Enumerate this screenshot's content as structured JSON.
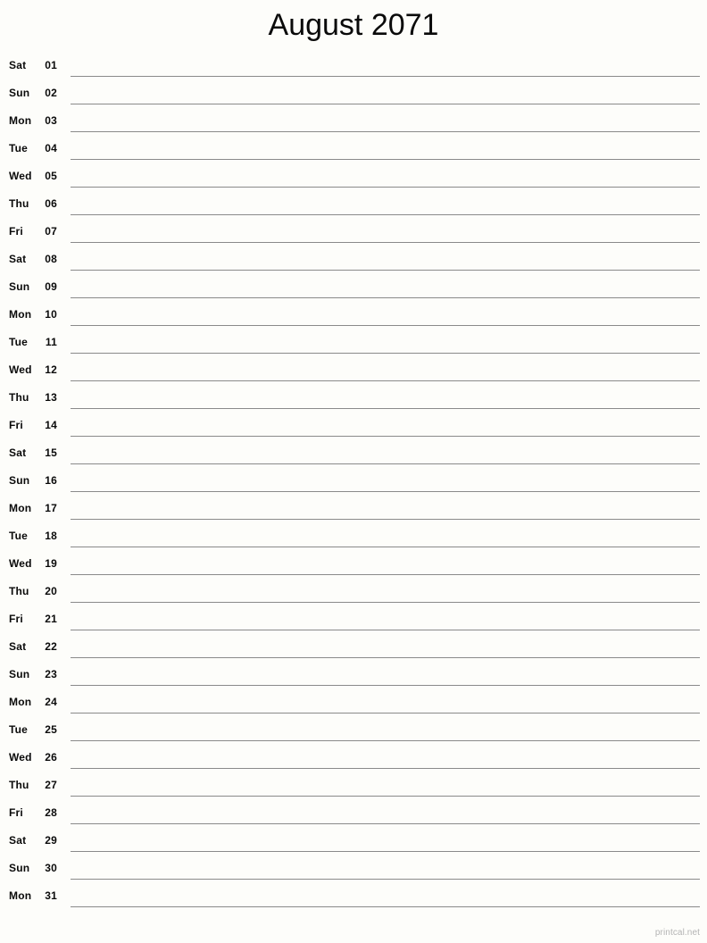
{
  "document": {
    "title": "August 2071",
    "month": "August",
    "year": "2071",
    "layout": "notes-column-single",
    "paper": "letter-portrait"
  },
  "colors": {
    "background": "#fdfdfa",
    "text": "#0a0a0a",
    "rule_line": "#8a8a8a",
    "footer_text": "#b4b4b4"
  },
  "days": [
    {
      "weekday": "Sat",
      "number": "01"
    },
    {
      "weekday": "Sun",
      "number": "02"
    },
    {
      "weekday": "Mon",
      "number": "03"
    },
    {
      "weekday": "Tue",
      "number": "04"
    },
    {
      "weekday": "Wed",
      "number": "05"
    },
    {
      "weekday": "Thu",
      "number": "06"
    },
    {
      "weekday": "Fri",
      "number": "07"
    },
    {
      "weekday": "Sat",
      "number": "08"
    },
    {
      "weekday": "Sun",
      "number": "09"
    },
    {
      "weekday": "Mon",
      "number": "10"
    },
    {
      "weekday": "Tue",
      "number": "11"
    },
    {
      "weekday": "Wed",
      "number": "12"
    },
    {
      "weekday": "Thu",
      "number": "13"
    },
    {
      "weekday": "Fri",
      "number": "14"
    },
    {
      "weekday": "Sat",
      "number": "15"
    },
    {
      "weekday": "Sun",
      "number": "16"
    },
    {
      "weekday": "Mon",
      "number": "17"
    },
    {
      "weekday": "Tue",
      "number": "18"
    },
    {
      "weekday": "Wed",
      "number": "19"
    },
    {
      "weekday": "Thu",
      "number": "20"
    },
    {
      "weekday": "Fri",
      "number": "21"
    },
    {
      "weekday": "Sat",
      "number": "22"
    },
    {
      "weekday": "Sun",
      "number": "23"
    },
    {
      "weekday": "Mon",
      "number": "24"
    },
    {
      "weekday": "Tue",
      "number": "25"
    },
    {
      "weekday": "Wed",
      "number": "26"
    },
    {
      "weekday": "Thu",
      "number": "27"
    },
    {
      "weekday": "Fri",
      "number": "28"
    },
    {
      "weekday": "Sat",
      "number": "29"
    },
    {
      "weekday": "Sun",
      "number": "30"
    },
    {
      "weekday": "Mon",
      "number": "31"
    }
  ],
  "footer": {
    "credit": "printcal.net"
  }
}
